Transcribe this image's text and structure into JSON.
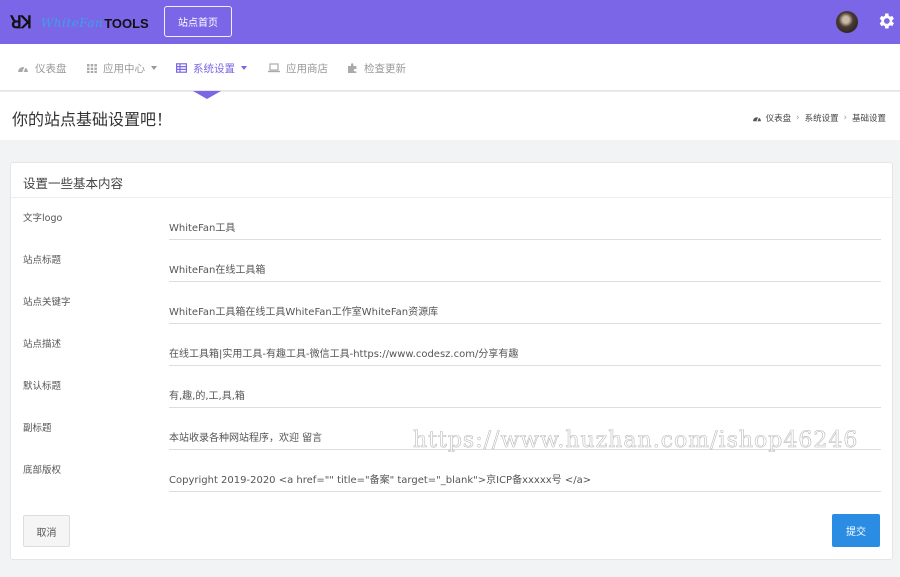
{
  "header": {
    "logo_mark": "ꓤꓘ",
    "logo_script": "WhiteFan",
    "logo_tools": "TOOLS",
    "home_button": "站点首页",
    "colors": {
      "bar": "#7a66e6"
    }
  },
  "nav": {
    "items": [
      {
        "label": "仪表盘",
        "icon": "dashboard-icon"
      },
      {
        "label": "应用中心",
        "icon": "grid-icon",
        "dropdown": true
      },
      {
        "label": "系统设置",
        "icon": "table-icon",
        "dropdown": true,
        "active": true
      },
      {
        "label": "应用商店",
        "icon": "laptop-icon"
      },
      {
        "label": "检查更新",
        "icon": "puzzle-icon"
      }
    ]
  },
  "page": {
    "title": "你的站点基础设置吧！",
    "breadcrumb": [
      "仪表盘",
      "系统设置",
      "基础设置"
    ]
  },
  "form": {
    "title": "设置一些基本内容",
    "fields": [
      {
        "label": "文字logo",
        "value": "WhiteFan工具"
      },
      {
        "label": "站点标题",
        "value": "WhiteFan在线工具箱"
      },
      {
        "label": "站点关键字",
        "value": "WhiteFan工具箱在线工具WhiteFan工作室WhiteFan资源库"
      },
      {
        "label": "站点描述",
        "value": "在线工具箱|实用工具-有趣工具-微信工具-https://www.codesz.com/分享有趣"
      },
      {
        "label": "默认标题",
        "value": "有,趣,的,工,具,箱"
      },
      {
        "label": "副标题",
        "value": "本站收录各种网站程序，欢迎 留言"
      },
      {
        "label": "底部版权",
        "value": "Copyright   2019-2020 <a href=\"\" title=\"备案\" target=\"_blank\">京ICP备xxxxx号 </a>"
      }
    ],
    "cancel": "取消",
    "submit": "提交"
  },
  "watermark": "https://www.huzhan.com/ishop46246"
}
